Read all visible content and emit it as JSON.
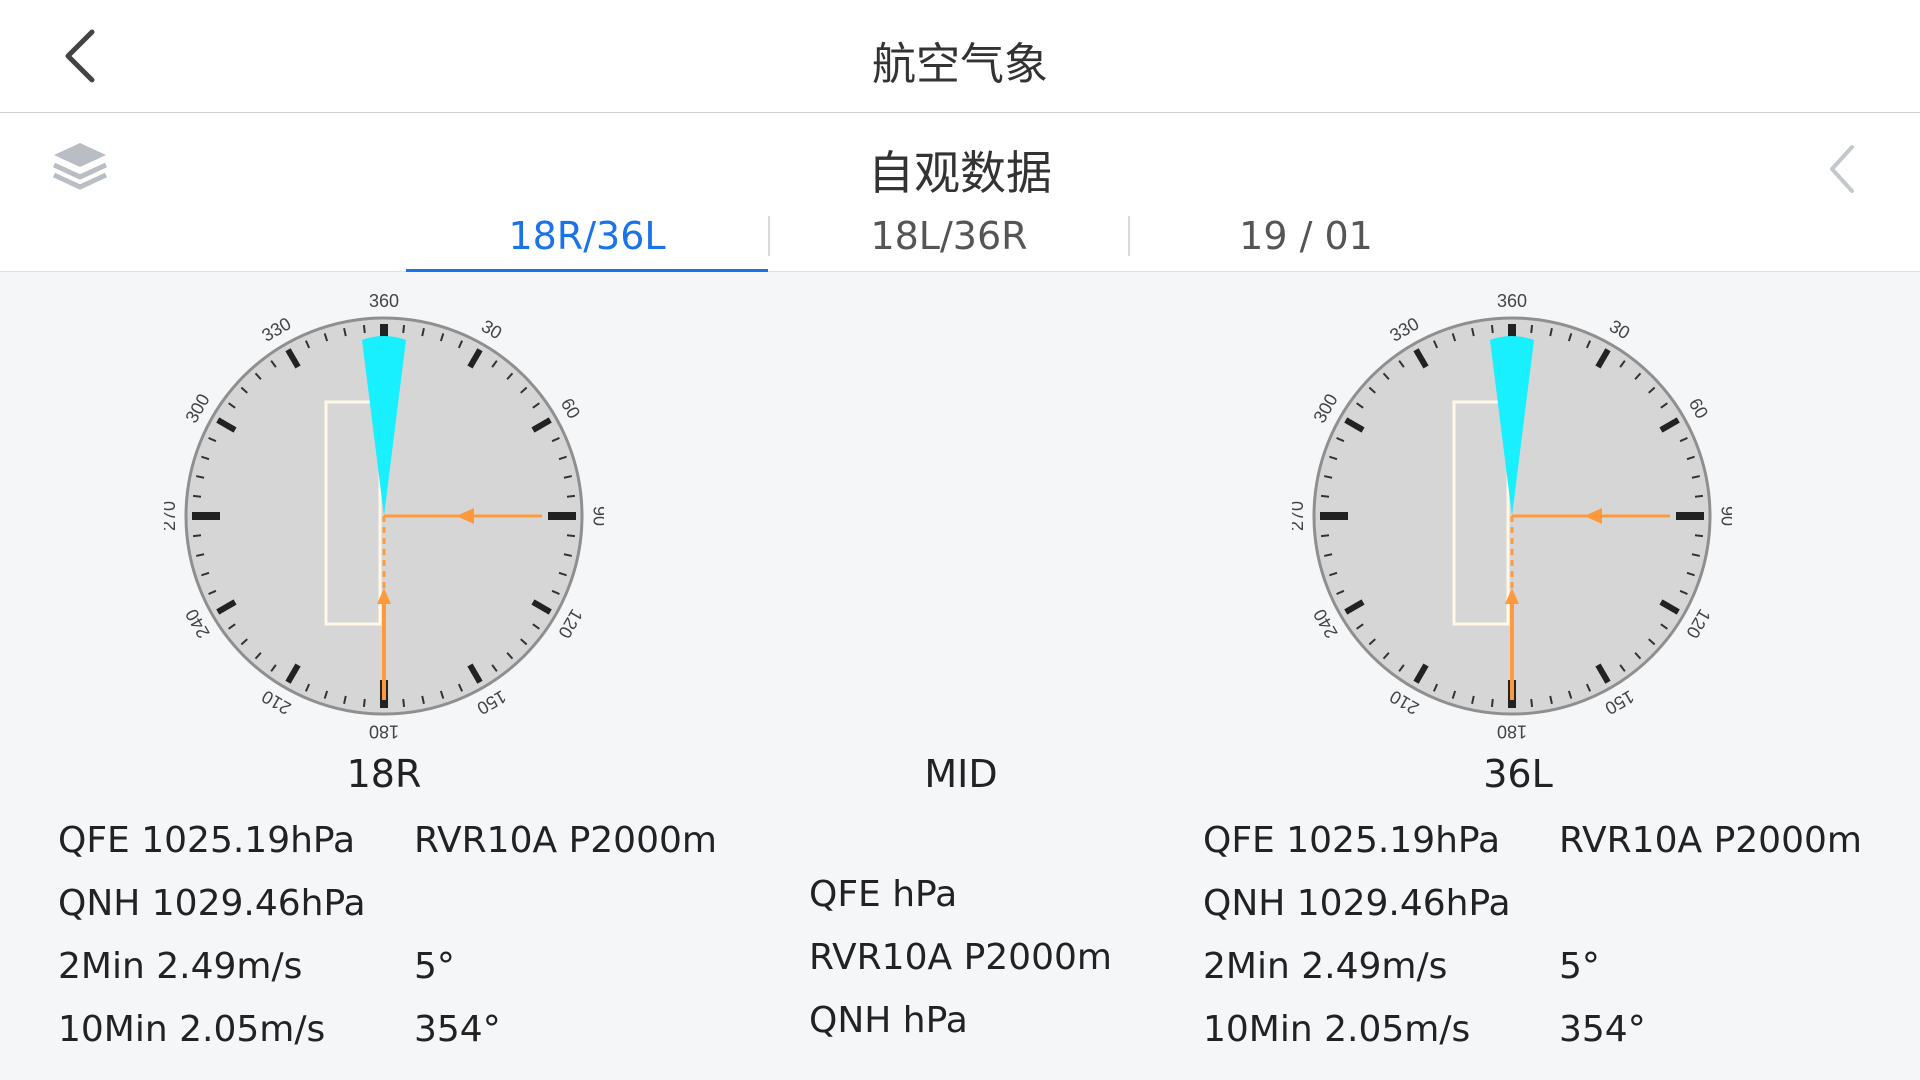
{
  "header": {
    "title": "航空气象",
    "back_icon": "chevron-left-icon"
  },
  "subheader": {
    "title": "自观数据",
    "layers_icon": "layers-icon",
    "collapse_icon": "chevron-left-icon",
    "tabs": [
      {
        "label": "18R/36L",
        "active": true
      },
      {
        "label": "18L/36R",
        "active": false
      },
      {
        "label": "19 / 01",
        "active": false
      }
    ]
  },
  "compass_ticks": {
    "n": "360",
    "ne30": "30",
    "ne60": "60",
    "e": "90",
    "se120": "120",
    "se150": "150",
    "s": "180",
    "sw210": "210",
    "sw240": "240",
    "w": "270",
    "nw300": "300",
    "nw330": "330"
  },
  "colors": {
    "accent": "#1a73e8",
    "wind_sector": "#18f0ff",
    "wind_arrow": "#ff9a3c",
    "dial": "#d6d6d6"
  },
  "left": {
    "runway": "18R",
    "qfe": "QFE 1025.19hPa",
    "rvr": "RVR10A P2000m",
    "qnh": "QNH 1029.46hPa",
    "wind2": "2Min 2.49m/s",
    "dir2": "5°",
    "wind10": "10Min 2.05m/s",
    "dir10": "354°"
  },
  "mid": {
    "runway": "MID",
    "qfe": "QFE hPa",
    "rvr": "RVR10A P2000m",
    "qnh": "QNH hPa"
  },
  "right": {
    "runway": "36L",
    "qfe": "QFE 1025.19hPa",
    "rvr": "RVR10A P2000m",
    "qnh": "QNH 1029.46hPa",
    "wind2": "2Min 2.49m/s",
    "dir2": "5°",
    "wind10": "10Min 2.05m/s",
    "dir10": "354°"
  }
}
